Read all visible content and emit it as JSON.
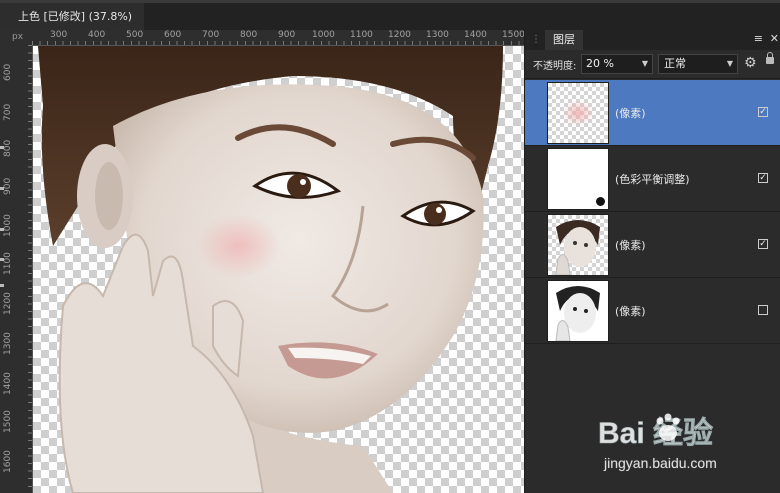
{
  "window": {
    "document_tab": "上色 [已修改] (37.8%)"
  },
  "ruler": {
    "unit": "px",
    "horizontal_ticks": [
      "300",
      "400",
      "500",
      "600",
      "700",
      "800",
      "900",
      "1000",
      "1100",
      "1200",
      "1300",
      "1400",
      "1500"
    ],
    "vertical_ticks": [
      "600",
      "700",
      "800",
      "900",
      "1000",
      "1100",
      "1200",
      "1300",
      "1400",
      "1500",
      "1600"
    ]
  },
  "layers_panel": {
    "tab_title": "图层",
    "opacity_label": "不透明度:",
    "opacity_value": "20 %",
    "blend_mode": "正常",
    "layers": [
      {
        "label": "(像素)",
        "selected": true,
        "visible": true
      },
      {
        "label": "(色彩平衡调整)",
        "selected": false,
        "visible": true
      },
      {
        "label": "(像素)",
        "selected": false,
        "visible": true
      },
      {
        "label": "(像素)",
        "selected": false,
        "visible": false
      }
    ]
  },
  "watermark": {
    "logo_text": "Bai 经验",
    "url": "jingyan.baidu.com"
  },
  "colors": {
    "selection": "#4d79c1",
    "annotation_arrow": "#f5e21b"
  }
}
